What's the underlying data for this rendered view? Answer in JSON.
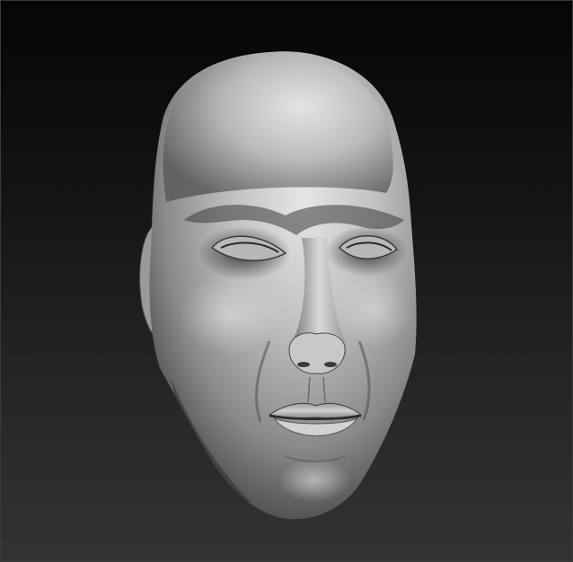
{
  "viewport": {
    "background_top": "#050505",
    "background_bottom": "#333333",
    "material_color": "#bdbdbd"
  },
  "model": {
    "subject": "sculpted-head-mesh",
    "shading": "matcap-gray"
  }
}
